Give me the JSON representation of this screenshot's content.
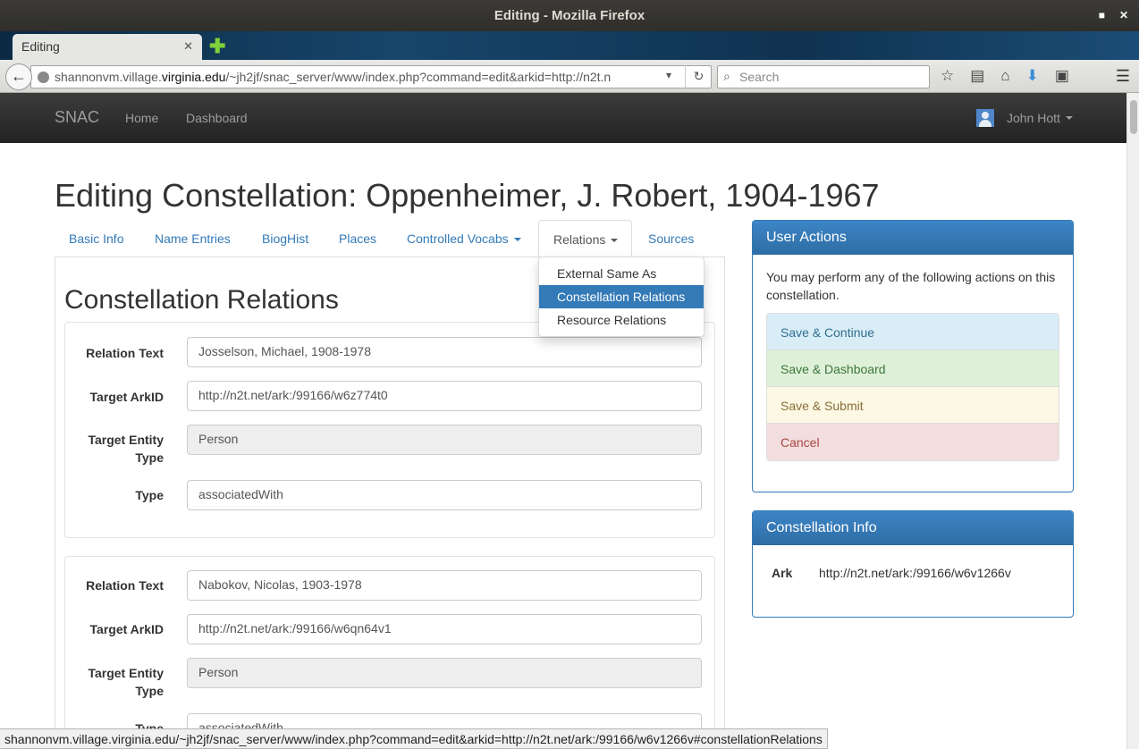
{
  "window": {
    "title": "Editing - Mozilla Firefox"
  },
  "browser": {
    "tab_title": "Editing",
    "url_prefix": "shannonvm.village.",
    "url_host": "virginia.edu",
    "url_path": "/~jh2jf/snac_server/www/index.php?command=edit&arkid=http://n2t.n",
    "search_placeholder": "Search",
    "status_url": "shannonvm.village.virginia.edu/~jh2jf/snac_server/www/index.php?command=edit&arkid=http://n2t.net/ark:/99166/w6v1266v#constellationRelations"
  },
  "site_nav": {
    "brand": "SNAC",
    "links": [
      "Home",
      "Dashboard"
    ],
    "user": "John Hott"
  },
  "page": {
    "title": "Editing Constellation: Oppenheimer, J. Robert, 1904-1967",
    "tabs": [
      "Basic Info",
      "Name Entries",
      "BiogHist",
      "Places",
      "Controlled Vocabs",
      "Relations",
      "Sources"
    ],
    "relations_menu": [
      "External Same As",
      "Constellation Relations",
      "Resource Relations"
    ],
    "section_title": "Constellation Relations",
    "labels": {
      "relation_text": "Relation Text",
      "target_arkid": "Target ArkID",
      "target_entity_type": "Target Entity Type",
      "type": "Type"
    },
    "relations": [
      {
        "relation_text": "Josselson, Michael, 1908-1978",
        "target_arkid": "http://n2t.net/ark:/99166/w6z774t0",
        "target_entity_type": "Person",
        "type": "associatedWith"
      },
      {
        "relation_text": "Nabokov, Nicolas, 1903-1978",
        "target_arkid": "http://n2t.net/ark:/99166/w6qn64v1",
        "target_entity_type": "Person",
        "type": "associatedWith"
      }
    ]
  },
  "user_actions": {
    "title": "User Actions",
    "description": "You may perform any of the following actions on this constellation.",
    "actions": [
      "Save & Continue",
      "Save & Dashboard",
      "Save & Submit",
      "Cancel"
    ]
  },
  "constellation_info": {
    "title": "Constellation Info",
    "ark_label": "Ark",
    "ark_value": "http://n2t.net/ark:/99166/w6v1266v"
  }
}
